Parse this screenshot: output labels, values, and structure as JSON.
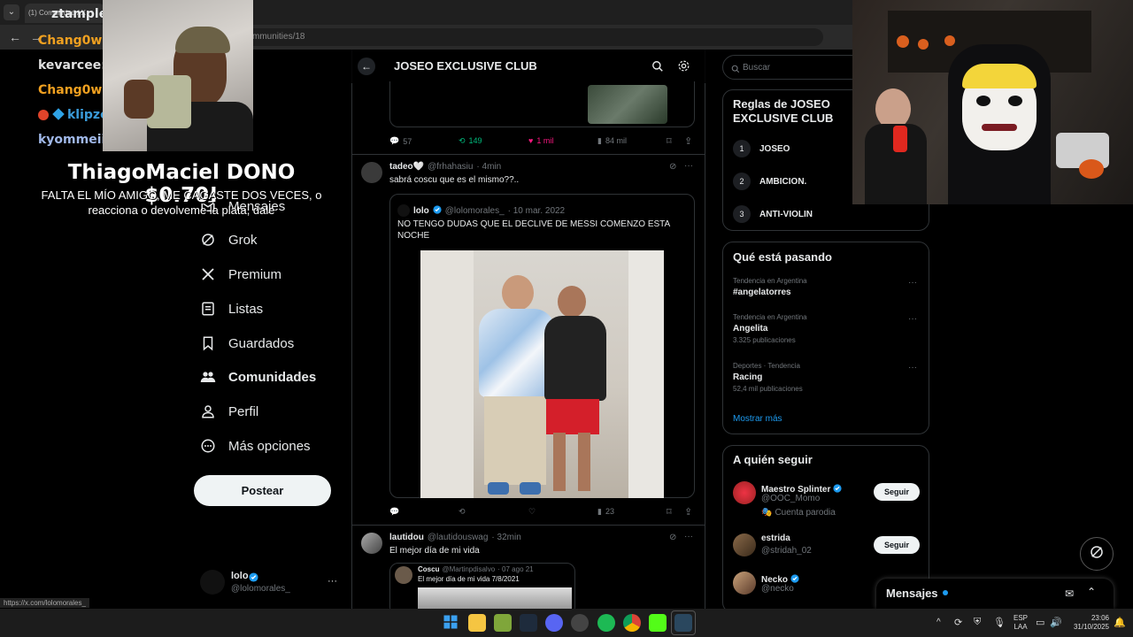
{
  "browser": {
    "tab_title": "(1) Comunidad / X",
    "url": "x.com/i/communities/18"
  },
  "stream_overlay": {
    "chat": [
      {
        "user": "ztample",
        "color": "#ffffff"
      },
      {
        "user": "Chang0w:",
        "color": "#f0a020"
      },
      {
        "user": "kevarcee:",
        "color": "#e0e0e0"
      },
      {
        "user": "Chang0w:",
        "color": "#f0a020"
      },
      {
        "user": "klipze",
        "color": "#3a9bd9"
      },
      {
        "user": "kyommeii:",
        "color": "#a0b8e8"
      }
    ],
    "donation_title": "ThiagoMaciel DONO $0.70!",
    "donation_message": "FALTA EL MÍO AMIGO, ME CAGASTE DOS VECES, o reacciona o devolveme la plata, dale"
  },
  "sidebar": {
    "items": [
      {
        "label": "Mensajes",
        "icon": "mail-icon"
      },
      {
        "label": "Grok",
        "icon": "grok-icon"
      },
      {
        "label": "Premium",
        "icon": "x-logo-icon"
      },
      {
        "label": "Listas",
        "icon": "list-icon"
      },
      {
        "label": "Guardados",
        "icon": "bookmark-icon"
      },
      {
        "label": "Comunidades",
        "icon": "communities-icon"
      },
      {
        "label": "Perfil",
        "icon": "profile-icon"
      },
      {
        "label": "Más opciones",
        "icon": "more-icon"
      }
    ],
    "post_button": "Postear",
    "account": {
      "name": "lolo",
      "handle": "@lolomorales_",
      "more": "···"
    }
  },
  "community": {
    "title": "JOSEO EXCLUSIVE CLUB"
  },
  "tweets": [
    {
      "actions": {
        "replies": "57",
        "retweets": "149",
        "likes": "1 mil",
        "views": "84 mil"
      }
    },
    {
      "name": "tadeo🤍",
      "handle": "@frhahasiu",
      "time": "· 4min",
      "text": "sabrá coscu que es el mismo??..",
      "quote": {
        "name": "lolo",
        "handle": "@lolomorales_",
        "time": "· 10 mar. 2022",
        "text": "NO TENGO DUDAS QUE EL DECLIVE DE MESSI COMENZO ESTA NOCHE"
      },
      "actions": {
        "views": "23"
      }
    },
    {
      "name": "lautidou",
      "handle": "@lautidouswag",
      "time": "· 32min",
      "text": "El mejor día de mi vida",
      "quote": {
        "name": "Coscu",
        "handle": "@Martinpdisalvo",
        "time": "· 07 ago 21",
        "text": "El mejor día de mi vida 7/8/2021"
      }
    }
  ],
  "right": {
    "search_placeholder": "Buscar",
    "rules_title": "Reglas de JOSEO EXCLUSIVE CLUB",
    "rules": [
      {
        "n": "1",
        "text": "JOSEO"
      },
      {
        "n": "2",
        "text": "AMBICION."
      },
      {
        "n": "3",
        "text": "ANTI-VIOLIN"
      }
    ],
    "trends_title": "Qué está pasando",
    "trends": [
      {
        "context": "Tendencia en Argentina",
        "name": "#angelatorres",
        "count": ""
      },
      {
        "context": "Tendencia en Argentina",
        "name": "Angelita",
        "count": "3.325 publicaciones"
      },
      {
        "context": "Deportes · Tendencia",
        "name": "Racing",
        "count": "52,4 mil publicaciones"
      }
    ],
    "show_more": "Mostrar más",
    "who_title": "A quién seguir",
    "who": [
      {
        "name": "Maestro Splinter",
        "handle": "@OOC_Momo",
        "note": "Cuenta parodia",
        "button": "Seguir"
      },
      {
        "name": "estrida",
        "handle": "@stridah_02",
        "note": "",
        "button": "Seguir"
      },
      {
        "name": "Necko",
        "handle": "@necko",
        "note": "",
        "button": ""
      }
    ]
  },
  "messages_drawer": {
    "label": "Mensajes"
  },
  "status_url": "https://x.com/lolomorales_",
  "taskbar": {
    "lang_top": "ESP",
    "lang_bottom": "LAA",
    "time": "23:06",
    "date": "31/10/2025"
  }
}
